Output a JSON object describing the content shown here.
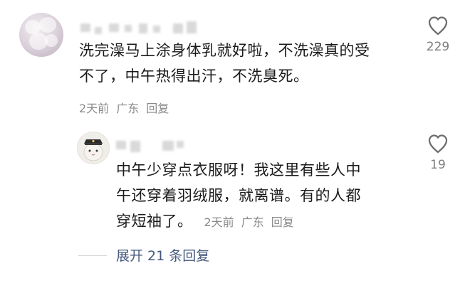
{
  "comments": [
    {
      "text_lines": [
        "洗完澡马上涂身体乳就好啦，不洗澡真的受",
        "不了，中午热得出汗，不洗臭死。"
      ],
      "time": "2天前",
      "location": "广东",
      "reply_label": "回复",
      "likes": "229",
      "avatar_icon": "flower-avatar-icon",
      "like_icon": "heart-outline-icon"
    },
    {
      "text_lines": [
        "中午少穿点衣服呀！我这里有些人中",
        "午还穿着羽绒服，就离谱。有的人都",
        "穿短袖了。"
      ],
      "time": "2天前",
      "location": "广东",
      "reply_label": "回复",
      "likes": "19",
      "avatar_icon": "cat-pirate-avatar-icon",
      "like_icon": "heart-outline-icon"
    }
  ],
  "expand_replies": "展开 21 条回复"
}
